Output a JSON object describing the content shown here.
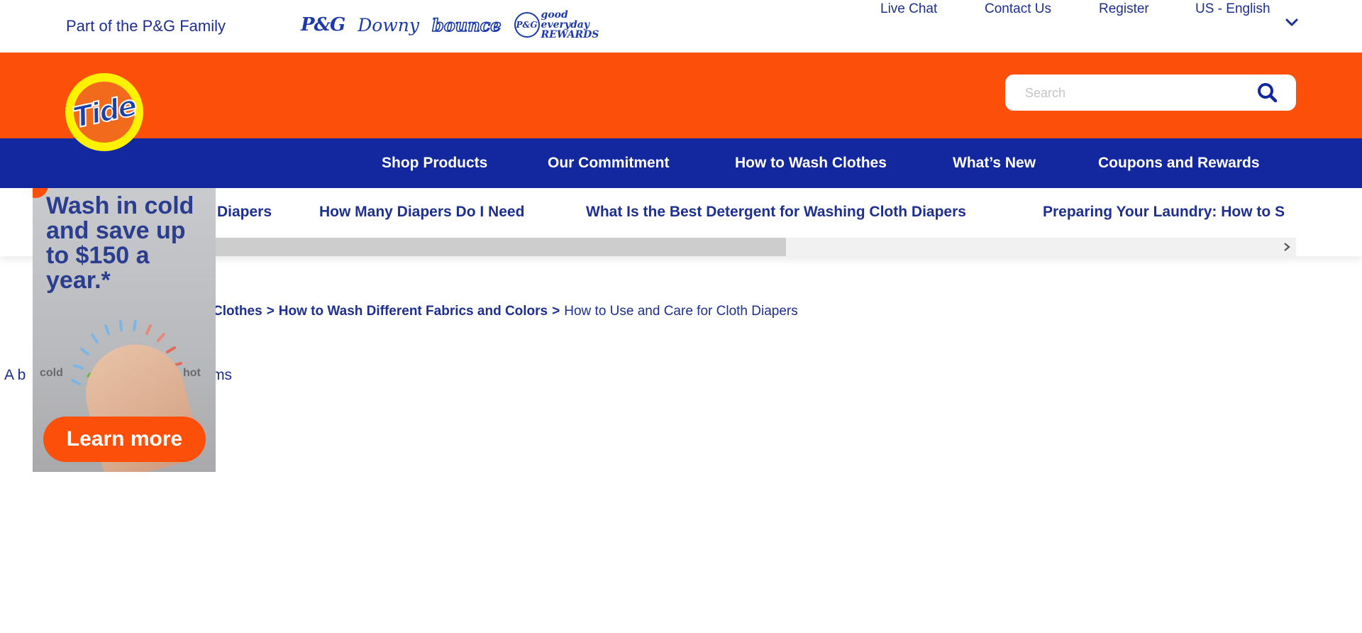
{
  "topbar": {
    "family_text": "Part of the P&G Family",
    "brands": [
      {
        "name": "P&G",
        "icon": "pg-logo"
      },
      {
        "name": "Downy",
        "icon": "downy-logo"
      },
      {
        "name": "bounce",
        "icon": "bounce-logo"
      },
      {
        "name": "good everyday REWARDS",
        "icon": "pg-good-everyday-logo"
      }
    ],
    "links": [
      "Live Chat",
      "Contact Us",
      "Register"
    ],
    "locale": "US - English"
  },
  "header": {
    "logo_text": "Tide",
    "search_placeholder": "Search"
  },
  "main_nav": [
    "Shop Products",
    "Our Commitment",
    "How to Wash Clothes",
    "What’s New",
    "Coupons and Rewards"
  ],
  "sub_nav": {
    "items": [
      "Diapers",
      "How Many Diapers Do I Need",
      "What Is the Best Detergent for Washing Cloth Diapers",
      "Preparing Your Laundry: How to S"
    ],
    "scroll_position": 0.53
  },
  "breadcrumb": {
    "links": [
      "Clothes",
      "How to Wash Different Fabrics and Colors"
    ],
    "separator": ">",
    "current": "How to Use and Care for Cloth Diapers"
  },
  "image_alt": {
    "left": "A b",
    "right": "er's arms"
  },
  "ad": {
    "headline": "Wash in cold and save up to $150 a year.*",
    "cold_label": "cold",
    "hot_label": "hot",
    "cta": "Learn more"
  },
  "colors": {
    "orange": "#fb4f0a",
    "navy": "#13279f",
    "text_blue": "#1d2f8f"
  }
}
